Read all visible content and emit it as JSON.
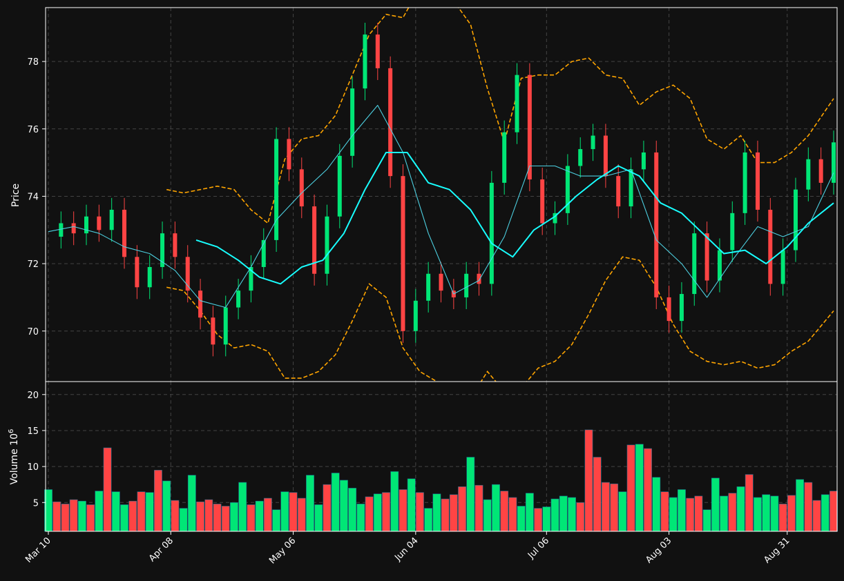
{
  "chart_data": [
    {
      "type": "candlestick",
      "name_hint": "price-panel",
      "ylabel": "Price",
      "ylim": [
        68.5,
        79.6
      ],
      "yticks": [
        70,
        72,
        74,
        76,
        78
      ],
      "grid": true,
      "x_start_date": "2024-03-10",
      "x_range_days": [
        0,
        186
      ],
      "xtick_labels": [
        "Mar 10",
        "Apr 08",
        "May 06",
        "Jun 04",
        "Jul 06",
        "Aug 03",
        "Aug 31"
      ],
      "xtick_days": [
        0,
        29,
        58,
        87,
        118,
        147,
        175
      ],
      "colors": {
        "up": "#00e676",
        "down": "#ff4444",
        "sma_fast": "#4dd0e1",
        "sma_slow": "#18ffff",
        "bands": "#ffa500",
        "background": "#111111",
        "frame": "#ffffff",
        "grid": "#444444"
      },
      "series": [
        {
          "role": "close",
          "x": [
            0,
            3,
            6,
            9,
            12,
            15,
            18,
            21,
            24,
            27,
            30,
            33,
            36,
            39,
            42,
            45,
            48,
            51,
            54,
            57,
            60,
            63,
            66,
            69,
            72,
            75,
            78,
            81,
            84,
            87,
            90,
            93,
            96,
            99,
            102,
            105,
            108,
            111,
            114,
            117,
            120,
            123,
            126,
            129,
            132,
            135,
            138,
            141,
            144,
            147,
            150,
            153,
            156,
            159,
            162,
            165,
            168,
            171,
            174,
            177,
            180,
            183,
            186
          ],
          "values": [
            72.8,
            73.2,
            72.9,
            73.4,
            73.0,
            73.6,
            72.2,
            71.3,
            71.9,
            72.9,
            72.2,
            71.2,
            70.4,
            69.6,
            70.7,
            71.2,
            71.9,
            72.7,
            75.7,
            74.8,
            73.7,
            71.7,
            73.4,
            75.2,
            77.2,
            78.8,
            77.8,
            74.6,
            70.0,
            70.9,
            71.7,
            71.2,
            71.0,
            71.7,
            71.4,
            74.4,
            75.9,
            77.6,
            74.5,
            73.2,
            73.5,
            74.9,
            75.4,
            75.8,
            74.6,
            73.7,
            74.8,
            75.3,
            71.0,
            70.3,
            71.1,
            72.9,
            71.5,
            72.4,
            73.5,
            75.3,
            73.6,
            71.4,
            72.4,
            74.2,
            75.1,
            74.4,
            75.6
          ]
        },
        {
          "role": "sma_fast",
          "name": "",
          "x": [
            0,
            6,
            12,
            18,
            24,
            30,
            36,
            42,
            48,
            54,
            60,
            66,
            72,
            78,
            84,
            90,
            96,
            102,
            108,
            114,
            120,
            126,
            132,
            138,
            144,
            150,
            156,
            162,
            168,
            174,
            180,
            186
          ],
          "values": [
            72.95,
            73.1,
            72.9,
            72.5,
            72.3,
            71.8,
            70.9,
            70.7,
            71.9,
            73.3,
            74.1,
            74.8,
            75.8,
            76.7,
            75.3,
            72.9,
            71.1,
            71.5,
            72.8,
            74.9,
            74.9,
            74.6,
            74.6,
            74.8,
            72.7,
            72.0,
            71.0,
            72.1,
            73.1,
            72.8,
            73.1,
            74.7
          ]
        },
        {
          "role": "sma_slow",
          "name": "",
          "x": [
            35,
            40,
            45,
            50,
            55,
            60,
            65,
            70,
            75,
            80,
            85,
            90,
            95,
            100,
            105,
            110,
            115,
            120,
            125,
            130,
            135,
            140,
            145,
            150,
            155,
            160,
            165,
            170,
            175,
            180,
            186
          ],
          "values": [
            72.7,
            72.5,
            72.1,
            71.6,
            71.4,
            71.9,
            72.1,
            72.9,
            74.2,
            75.3,
            75.3,
            74.4,
            74.2,
            73.6,
            72.6,
            72.2,
            73.0,
            73.4,
            74.0,
            74.5,
            74.9,
            74.6,
            73.8,
            73.5,
            72.9,
            72.3,
            72.4,
            72.0,
            72.5,
            73.2,
            73.8
          ]
        },
        {
          "role": "band_upper",
          "name": "",
          "x": [
            28,
            32,
            36,
            40,
            44,
            48,
            52,
            56,
            60,
            64,
            68,
            72,
            76,
            80,
            84,
            88,
            92,
            96,
            100,
            104,
            108,
            112,
            116,
            120,
            124,
            128,
            132,
            136,
            140,
            144,
            148,
            152,
            156,
            160,
            164,
            168,
            172,
            176,
            180,
            186
          ],
          "values": [
            74.2,
            74.1,
            74.2,
            74.3,
            74.2,
            73.6,
            73.2,
            75.1,
            75.7,
            75.8,
            76.4,
            77.6,
            78.8,
            79.4,
            79.3,
            80.2,
            80.0,
            79.8,
            79.1,
            77.2,
            75.6,
            77.5,
            77.6,
            77.6,
            78.0,
            78.1,
            77.6,
            77.5,
            76.7,
            77.1,
            77.3,
            76.9,
            75.7,
            75.4,
            75.8,
            75.0,
            75.0,
            75.3,
            75.8,
            76.9
          ]
        },
        {
          "role": "band_lower",
          "name": "",
          "x": [
            28,
            32,
            36,
            40,
            44,
            48,
            52,
            56,
            60,
            64,
            68,
            72,
            76,
            80,
            84,
            88,
            92,
            96,
            100,
            104,
            108,
            112,
            116,
            120,
            124,
            128,
            132,
            136,
            140,
            144,
            148,
            152,
            156,
            160,
            164,
            168,
            172,
            176,
            180,
            186
          ],
          "values": [
            71.3,
            71.2,
            70.6,
            69.9,
            69.5,
            69.6,
            69.4,
            68.6,
            68.6,
            68.8,
            69.3,
            70.3,
            71.4,
            71.0,
            69.5,
            68.8,
            68.5,
            68.2,
            68.0,
            68.8,
            68.2,
            68.3,
            68.9,
            69.1,
            69.6,
            70.5,
            71.5,
            72.2,
            72.1,
            71.3,
            70.2,
            69.4,
            69.1,
            69.0,
            69.1,
            68.9,
            69.0,
            69.4,
            69.7,
            70.6
          ]
        }
      ]
    },
    {
      "type": "bar",
      "name_hint": "volume-panel",
      "ylabel": "Volume  10",
      "ylabel_exponent": "6",
      "ylim": [
        1.0,
        21.8
      ],
      "yticks": [
        5,
        10,
        15,
        20
      ],
      "grid": true,
      "x_range_days": [
        0,
        186
      ],
      "x": [
        0,
        2,
        4,
        6,
        8,
        10,
        12,
        14,
        16,
        18,
        20,
        22,
        24,
        26,
        28,
        30,
        32,
        34,
        36,
        38,
        40,
        42,
        44,
        46,
        48,
        50,
        52,
        54,
        56,
        58,
        60,
        62,
        64,
        66,
        68,
        70,
        72,
        74,
        76,
        78,
        80,
        82,
        84,
        86,
        88,
        90,
        92,
        94,
        96,
        98,
        100,
        102,
        104,
        106,
        108,
        110,
        112,
        114,
        116,
        118,
        120,
        122,
        124,
        126,
        128,
        130,
        132,
        134,
        136,
        138,
        140,
        142,
        144,
        146,
        148,
        150,
        152,
        154,
        156,
        158,
        160,
        162,
        164,
        166,
        168,
        170,
        172,
        174,
        176,
        178,
        180,
        182,
        184,
        186
      ],
      "values": [
        6.8,
        5.1,
        4.8,
        5.4,
        5.2,
        4.7,
        6.6,
        12.6,
        6.5,
        4.7,
        5.2,
        6.5,
        6.4,
        9.5,
        8.0,
        5.3,
        4.2,
        8.8,
        5.1,
        5.4,
        4.8,
        4.5,
        5.0,
        7.8,
        4.7,
        5.2,
        5.6,
        4.0,
        6.5,
        6.4,
        5.6,
        8.8,
        4.7,
        7.5,
        9.1,
        8.1,
        7.0,
        4.8,
        5.8,
        6.2,
        6.4,
        9.3,
        6.8,
        8.3,
        6.4,
        4.2,
        6.2,
        5.5,
        6.1,
        7.2,
        11.3,
        7.4,
        5.4,
        7.5,
        6.6,
        5.7,
        4.5,
        6.3,
        4.2,
        4.4,
        5.5,
        5.9,
        5.7,
        5.0,
        15.1,
        11.3,
        7.8,
        7.6,
        6.5,
        13.0,
        13.1,
        12.5,
        8.5,
        6.5,
        5.7,
        6.8,
        5.6,
        5.9,
        4.0,
        8.4,
        5.9,
        6.3,
        7.2,
        8.9,
        5.7,
        6.1,
        5.9,
        4.8,
        6.0,
        8.2,
        7.8,
        5.3,
        6.1,
        6.6
      ],
      "colors_up_down": "UDDDUDUDUUDDUDUDUUDDDDUUDUDUUDDUUDUUUUDUDUDUDUUDDDUDUUDDUUDUUUUDDDDDUDUDUDUUDDUUUDUDUUUDDUDDUDU"
    }
  ]
}
